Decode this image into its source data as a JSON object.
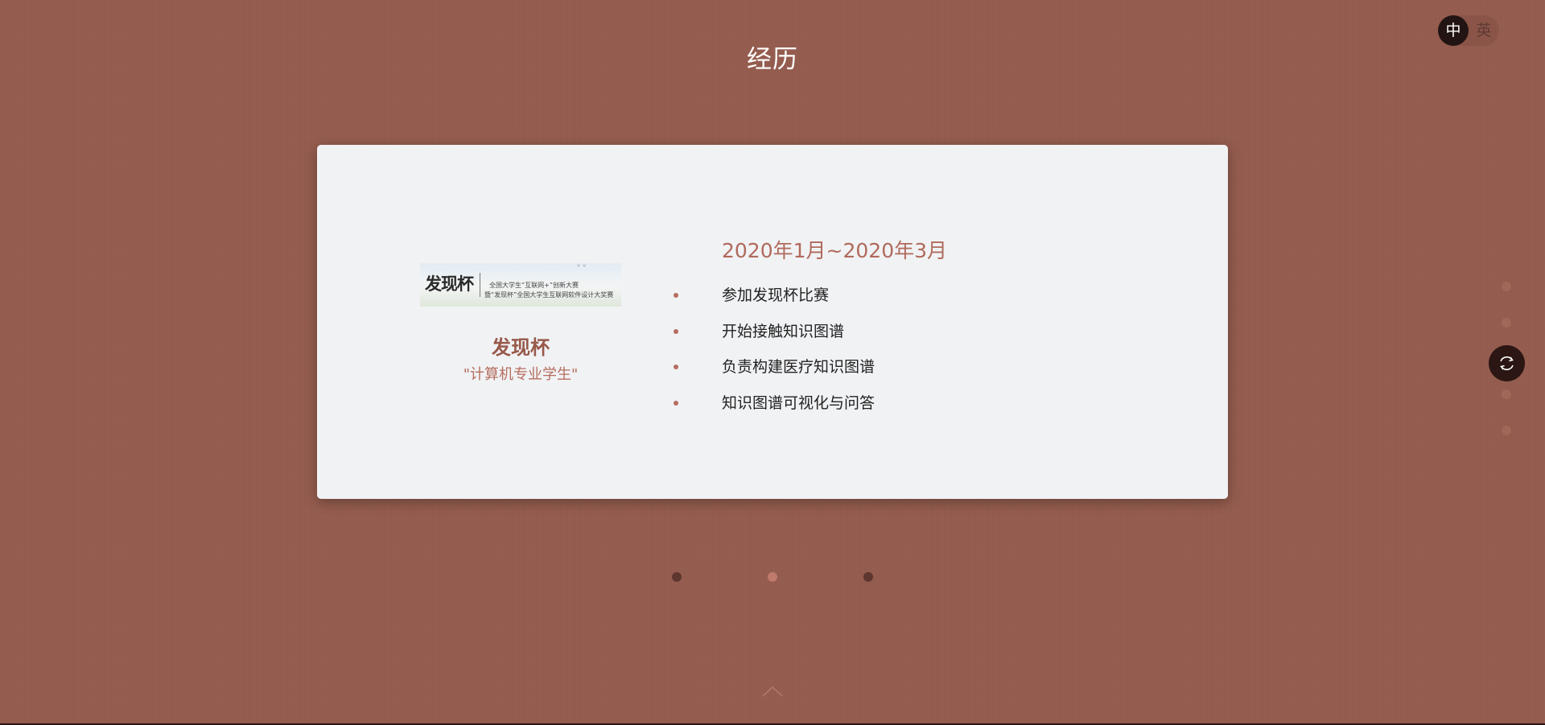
{
  "section": {
    "title": "经历"
  },
  "language_switch": {
    "zh_label": "中",
    "en_label": "英",
    "active": "zh"
  },
  "experience": {
    "logo": {
      "main_text": "发现杯",
      "line1": "全国大学生“互联网+”创新大赛",
      "line2": "暨“发现杯”全国大学生互联网软件设计大奖赛"
    },
    "org_name": "发现杯",
    "role": "\"计算机专业学生\"",
    "period": "2020年1月~2020年3月",
    "duties": [
      "参加发现杯比赛",
      "开始接触知识图谱",
      "负责构建医疗知识图谱",
      "知识图谱可视化与问答"
    ]
  },
  "carousel": {
    "slide_count": 3,
    "active_index": 1
  },
  "side_nav": {
    "item_count": 5,
    "active_index": 2,
    "active_icon": "refresh-icon"
  },
  "footer": {
    "icon": "chevron-up-icon"
  },
  "colors": {
    "background": "#955c4e",
    "card": "#f1f2f4",
    "accent": "#b06a5c",
    "heading": "#98594a",
    "dark": "#221412"
  }
}
